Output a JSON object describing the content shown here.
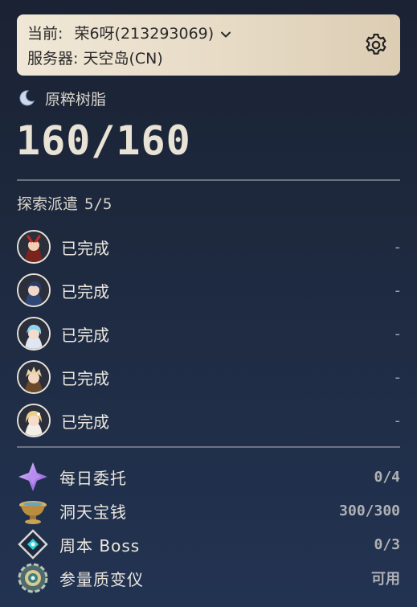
{
  "account": {
    "current_label": "当前:",
    "name": "荣6呀",
    "uid": "(213293069)",
    "server_label": "服务器:",
    "server": "天空岛(CN)"
  },
  "resin": {
    "label": "原粹树脂",
    "value": "160/160"
  },
  "expeditions": {
    "title": "探索派遣",
    "count": "5/5",
    "items": [
      {
        "status": "已完成",
        "time": "-",
        "avatar": "amber-avatar-icon"
      },
      {
        "status": "已完成",
        "time": "-",
        "avatar": "xingqiu-avatar-icon"
      },
      {
        "status": "已完成",
        "time": "-",
        "avatar": "chongyun-avatar-icon"
      },
      {
        "status": "已完成",
        "time": "-",
        "avatar": "bennett-avatar-icon"
      },
      {
        "status": "已完成",
        "time": "-",
        "avatar": "lumine-avatar-icon"
      }
    ]
  },
  "tasks": [
    {
      "label": "每日委托",
      "value": "0/4",
      "icon": "daily-commission-icon"
    },
    {
      "label": "洞天宝钱",
      "value": "300/300",
      "icon": "realm-currency-icon"
    },
    {
      "label": "周本 Boss",
      "value": "0/3",
      "icon": "weekly-boss-icon"
    },
    {
      "label": "参量质变仪",
      "value": "可用",
      "icon": "parametric-transformer-icon"
    }
  ],
  "colors": {
    "background_top": "#1b2233",
    "background_bottom": "#223352",
    "card": "#e7dbc6",
    "text": "#e6e2d8",
    "muted": "#b0b1b5"
  }
}
